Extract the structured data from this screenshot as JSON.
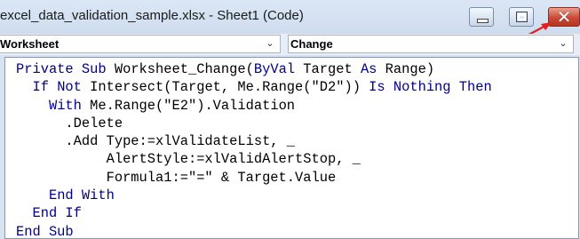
{
  "window": {
    "title": "excel_data_validation_sample.xlsx - Sheet1 (Code)",
    "buttons": {
      "minimize": "minimize-icon",
      "maximize": "maximize-icon",
      "close": "close-icon"
    },
    "annotation_arrow_color": "#e02020"
  },
  "combos": {
    "object": "Worksheet",
    "procedure": "Change"
  },
  "colors": {
    "keyword": "#00008b",
    "text": "#000000",
    "close_button": "#c94a35"
  },
  "code": {
    "lines": [
      [
        {
          "t": "Private Sub ",
          "k": 1
        },
        {
          "t": "Worksheet_Change(",
          "k": 0
        },
        {
          "t": "ByVal ",
          "k": 1
        },
        {
          "t": "Target ",
          "k": 0
        },
        {
          "t": "As ",
          "k": 1
        },
        {
          "t": "Range)",
          "k": 0
        }
      ],
      [
        {
          "t": "  ",
          "k": 0
        },
        {
          "t": "If Not ",
          "k": 1
        },
        {
          "t": "Intersect(Target, Me.Range(\"D2\")) ",
          "k": 0
        },
        {
          "t": "Is Nothing Then",
          "k": 1
        }
      ],
      [
        {
          "t": "    ",
          "k": 0
        },
        {
          "t": "With ",
          "k": 1
        },
        {
          "t": "Me.Range(\"E2\").Validation",
          "k": 0
        }
      ],
      [
        {
          "t": "      .Delete",
          "k": 0
        }
      ],
      [
        {
          "t": "      .Add Type:=xlValidateList, _",
          "k": 0
        }
      ],
      [
        {
          "t": "           AlertStyle:=xlValidAlertStop, _",
          "k": 0
        }
      ],
      [
        {
          "t": "           Formula1:=\"=\" & Target.Value",
          "k": 0
        }
      ],
      [
        {
          "t": "    ",
          "k": 0
        },
        {
          "t": "End With",
          "k": 1
        }
      ],
      [
        {
          "t": "  ",
          "k": 0
        },
        {
          "t": "End If",
          "k": 1
        }
      ],
      [
        {
          "t": "End Sub",
          "k": 1
        }
      ]
    ]
  }
}
